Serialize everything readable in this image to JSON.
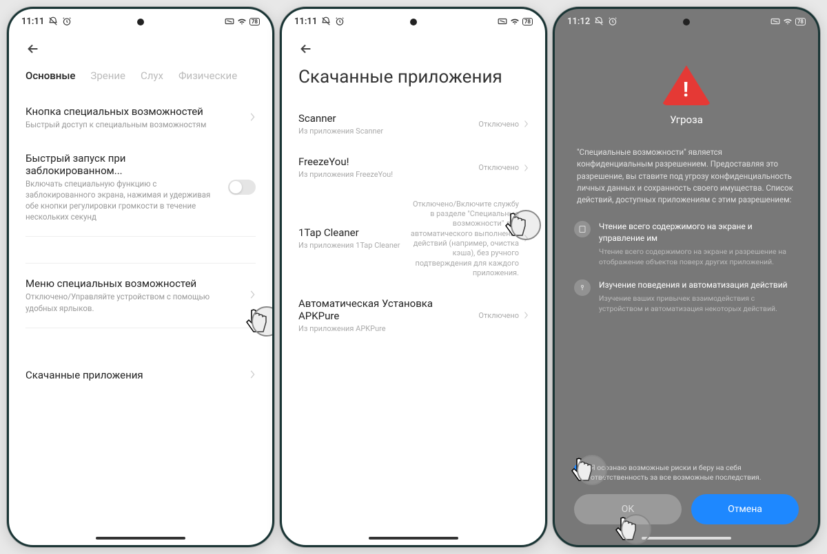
{
  "screen1": {
    "time": "11:11",
    "battery": "78",
    "tabs": [
      "Основные",
      "Зрение",
      "Слух",
      "Физические"
    ],
    "item1_title": "Кнопка специальных возможностей",
    "item1_sub": "Быстрый доступ к специальным возможностям",
    "item2_title": "Быстрый запуск при заблокированном...",
    "item2_sub": "Включать специальную функцию с заблокированного экрана, нажимая и удерживая обе кнопки регулировки громкости в течение нескольких секунд",
    "item3_title": "Меню специальных возможностей",
    "item3_sub": "Отключено/Управляйте устройством с помощью удобных ярлыков.",
    "item4_title": "Скачанные приложения"
  },
  "screen2": {
    "time": "11:11",
    "battery": "78",
    "page_title": "Скачанные приложения",
    "apps": [
      {
        "name": "Scanner",
        "sub": "Из приложения Scanner",
        "status": "Отключено"
      },
      {
        "name": "FreezeYou!",
        "sub": "Из приложения FreezeYou!",
        "status": "Отключено"
      },
      {
        "name": "1Tap Cleaner",
        "sub": "Из приложения 1Tap Cleaner",
        "status": "Отключено/Включите службу в разделе \"Специальные возможности\" для автоматического выполнения действий (например, очистка кэша), без ручного подтверждения для каждого приложения."
      },
      {
        "name": "Автоматическая Установка APKPure",
        "sub": "Из приложения APKPure",
        "status": "Отключено"
      }
    ]
  },
  "screen3": {
    "time": "11:12",
    "battery": "78",
    "warn_title": "Угроза",
    "warn_desc": "\"Специальные возможности\" является конфиденциальным разрешением. Предоставляя это разрешение, вы ставите под угрозу конфиденциальность личных данных и сохранность своего имущества. Список действий, доступных приложениям с этим разрешением:",
    "perm1_title": "Чтение всего содержимого на экране и управление им",
    "perm1_sub": "Чтение всего содержимого на экране и разрешение на отображение объектов поверх других приложений.",
    "perm2_title": "Изучение поведения и автоматизация действий",
    "perm2_sub": "Изучение ваших привычек взаимодействия с устройством и автоматизация некоторых действий.",
    "consent": "Я осознаю возможные риски и беру на себя ответственность за все возможные последствия.",
    "ok": "OK",
    "cancel": "Отмена"
  }
}
